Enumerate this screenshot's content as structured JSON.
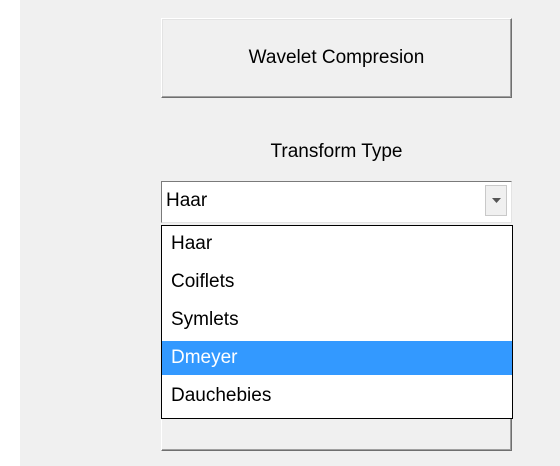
{
  "panel": {
    "compress_button_label": "Wavelet Compresion",
    "transform_label": "Transform Type"
  },
  "combo": {
    "value": "Haar",
    "arrow_icon": "chevron-down-icon"
  },
  "dropdown": {
    "items": [
      {
        "label": "Haar",
        "selected": false
      },
      {
        "label": "Coiflets",
        "selected": false
      },
      {
        "label": "Symlets",
        "selected": false
      },
      {
        "label": "Dmeyer",
        "selected": true
      },
      {
        "label": "Dauchebies",
        "selected": false
      }
    ]
  },
  "colors": {
    "panel_background": "#f0f0f0",
    "selection_background": "#3399ff",
    "selection_text": "#ffffff"
  }
}
